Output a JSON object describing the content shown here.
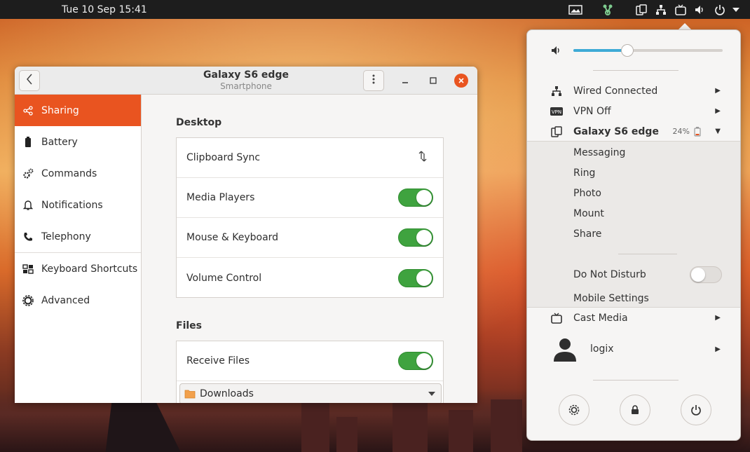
{
  "topbar": {
    "datetime": "Tue 10 Sep  15:41",
    "icons": [
      "screenshot-icon",
      "gsconnect-app-icon",
      "phone-connected-icon",
      "network-wired-icon",
      "cast-icon",
      "volume-icon",
      "power-icon",
      "menu-arrow-icon"
    ]
  },
  "window": {
    "title": "Galaxy S6 edge",
    "subtitle": "Smartphone",
    "back_icon": "back-icon",
    "menu_icon": "kebab-menu-icon"
  },
  "sidebar": {
    "items": [
      {
        "label": "Sharing",
        "icon": "share-icon",
        "active": true
      },
      {
        "label": "Battery",
        "icon": "battery-icon",
        "active": false
      },
      {
        "label": "Commands",
        "icon": "commands-icon",
        "active": false
      },
      {
        "label": "Notifications",
        "icon": "bell-icon",
        "active": false
      },
      {
        "label": "Telephony",
        "icon": "phone-icon",
        "active": false
      },
      {
        "label": "Keyboard Shortcuts",
        "icon": "keyboard-shortcuts-icon",
        "active": false
      },
      {
        "label": "Advanced",
        "icon": "advanced-icon",
        "active": false
      }
    ]
  },
  "desktop": {
    "title": "Desktop",
    "rows": [
      {
        "label": "Clipboard Sync",
        "control": "sync-icon"
      },
      {
        "label": "Media Players",
        "control": "switch",
        "on": true
      },
      {
        "label": "Mouse & Keyboard",
        "control": "switch",
        "on": true
      },
      {
        "label": "Volume Control",
        "control": "switch",
        "on": true
      }
    ]
  },
  "files": {
    "title": "Files",
    "rows": [
      {
        "label": "Receive Files",
        "control": "switch",
        "on": true
      }
    ],
    "folder": "Downloads"
  },
  "menu": {
    "volume_level": 0.36,
    "network": "Wired Connected",
    "vpn": "VPN Off",
    "device": "Galaxy S6 edge",
    "battery": "24%",
    "device_items": [
      "Messaging",
      "Ring",
      "Photo",
      "Mount",
      "Share"
    ],
    "do_not_disturb": "Do Not Disturb",
    "do_not_disturb_on": false,
    "mobile_settings": "Mobile Settings",
    "cast": "Cast Media",
    "user": "logix",
    "bottom_buttons": [
      "settings-icon",
      "lock-icon",
      "power-icon"
    ]
  },
  "colors": {
    "accent": "#e95420",
    "switch_on": "#3fa33f",
    "volume": "#3eaad6"
  }
}
